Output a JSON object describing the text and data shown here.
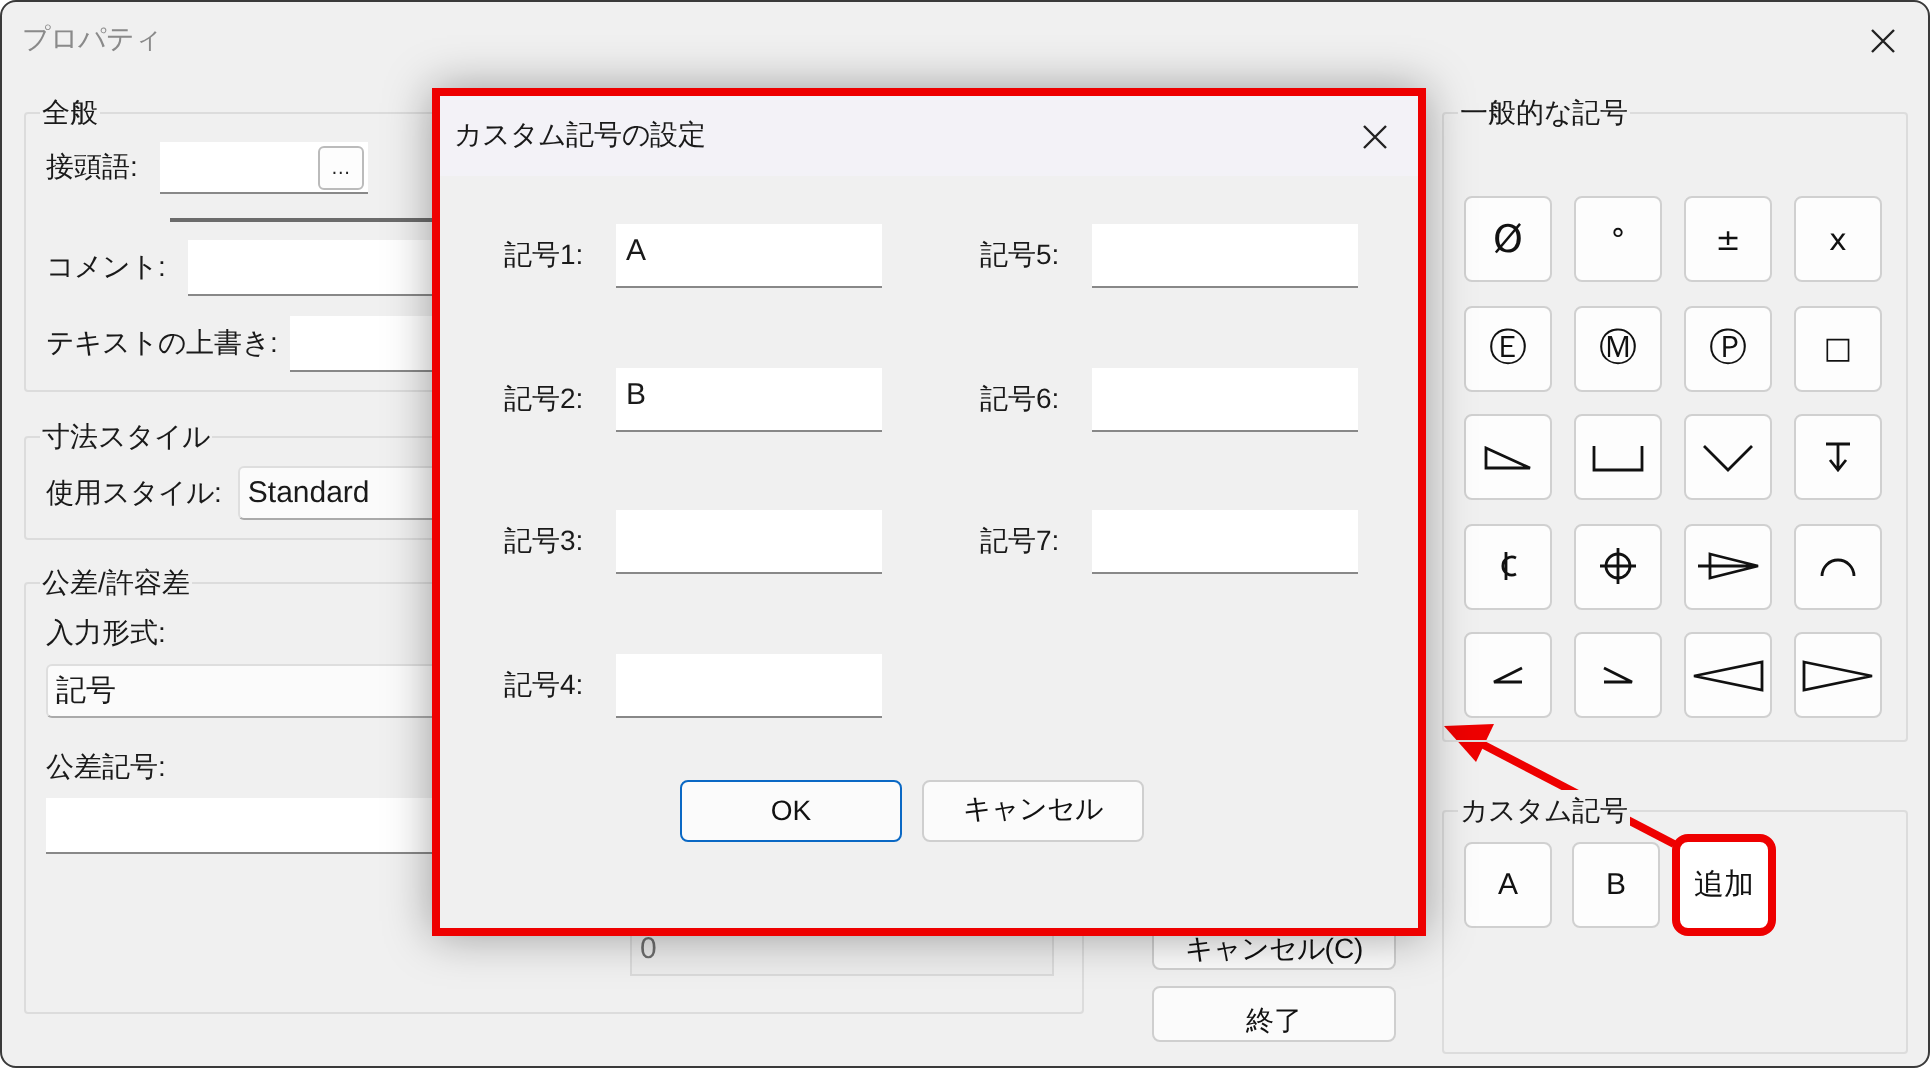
{
  "window": {
    "title": "プロパティ"
  },
  "general": {
    "title": "全般",
    "prefix": {
      "label": "接頭語:",
      "button": "…"
    },
    "comment": {
      "label": "コメント:"
    },
    "override": {
      "label": "テキストの上書き:"
    }
  },
  "dimension_style": {
    "title": "寸法スタイル",
    "label": "使用スタイル:",
    "value": "Standard"
  },
  "tolerance": {
    "title": "公差/許容差",
    "format_label": "入力形式:",
    "format_value": "記号",
    "symbol_label": "公差記号:",
    "value_field": {
      "value": "0",
      "disabled": true
    }
  },
  "buttons": [
    {
      "label": "キャンセル(C)"
    },
    {
      "label": "終了"
    }
  ],
  "common_symbols": {
    "title": "一般的な記号",
    "items": [
      {
        "kind": "char",
        "label": "Ø"
      },
      {
        "kind": "char",
        "label": "°"
      },
      {
        "kind": "char",
        "label": "±"
      },
      {
        "kind": "char",
        "label": "x"
      },
      {
        "kind": "char",
        "label": "Ⓔ"
      },
      {
        "kind": "char",
        "label": "Ⓜ"
      },
      {
        "kind": "char",
        "label": "Ⓟ"
      },
      {
        "kind": "char",
        "label": "□"
      },
      {
        "kind": "wedge"
      },
      {
        "kind": "counterbore"
      },
      {
        "kind": "countersink"
      },
      {
        "kind": "depth"
      },
      {
        "kind": "centerline"
      },
      {
        "kind": "position"
      },
      {
        "kind": "conical"
      },
      {
        "kind": "arc"
      },
      {
        "kind": "lessangle"
      },
      {
        "kind": "greaterangle"
      },
      {
        "kind": "lefttriangle"
      },
      {
        "kind": "righttriangle"
      }
    ]
  },
  "custom_symbols": {
    "title": "カスタム記号",
    "items": [
      {
        "label": "A",
        "highlighted": false
      },
      {
        "label": "B",
        "highlighted": false
      },
      {
        "label": "追加",
        "highlighted": true
      }
    ]
  },
  "dialog": {
    "title": "カスタム記号の設定",
    "highlighted": true,
    "fields": [
      {
        "label": "記号1:",
        "value": "A"
      },
      {
        "label": "記号2:",
        "value": "B"
      },
      {
        "label": "記号3:"
      },
      {
        "label": "記号4:"
      },
      {
        "label": "記号5:"
      },
      {
        "label": "記号6:"
      },
      {
        "label": "記号7:"
      }
    ],
    "buttons": [
      {
        "label": "OK",
        "default": true
      },
      {
        "label": "キャンセル",
        "default": false
      }
    ]
  }
}
